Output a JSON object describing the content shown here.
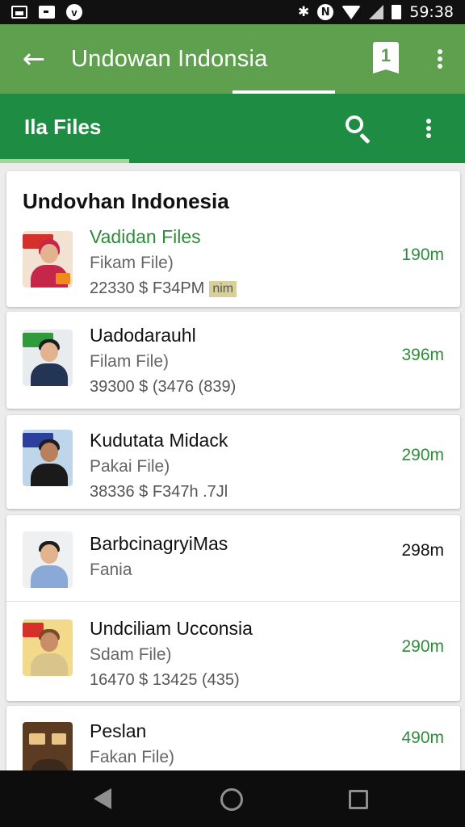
{
  "status_bar": {
    "time": "59:38",
    "icons": [
      "gallery-icon",
      "message-icon",
      "vodafone-icon",
      "bluetooth-icon",
      "nfc-icon",
      "wifi-icon",
      "signal-icon",
      "battery-icon"
    ]
  },
  "app_bar": {
    "title": "Undowan Indonsia",
    "book_number": "1",
    "back_icon": "arrow-left-icon",
    "menu_icon": "more-vert-icon"
  },
  "tab_bar": {
    "label": "Ila Files",
    "search_icon": "search-icon",
    "menu_icon": "more-vert-icon"
  },
  "colors": {
    "app_bar": "#5fa04f",
    "tab_bar": "#1e8c43",
    "accent_green": "#2e8b3a"
  },
  "section": {
    "title": "Undovhan Indonesia"
  },
  "items": [
    {
      "title": "Vadidan Files",
      "subtitle": "Fikam File)",
      "meta": "22330 $ F34PM",
      "badge": "nim",
      "size": "190m"
    },
    {
      "title": "Uadodarauhl",
      "subtitle": "Filam File)",
      "meta": "39300 $ (3476 (839)",
      "size": "396m"
    },
    {
      "title": "Kudutata Midack",
      "subtitle": "Pakai File)",
      "meta": "38336 $ F347h .7Jl",
      "size": "290m"
    },
    {
      "title": "BarbcinagryiMas",
      "subtitle": "Fania",
      "meta": "",
      "size": "298m"
    },
    {
      "title": "Undciliam Ucconsia",
      "subtitle": "Sdam File)",
      "meta": "16470 $ 13425 (435)",
      "size": "290m"
    },
    {
      "title": "Peslan",
      "subtitle": "Fakan File)",
      "meta": "",
      "size": "490m"
    }
  ],
  "nav_bar": {
    "back_icon": "nav-back-icon",
    "home_icon": "nav-home-icon",
    "recents_icon": "nav-recents-icon"
  }
}
